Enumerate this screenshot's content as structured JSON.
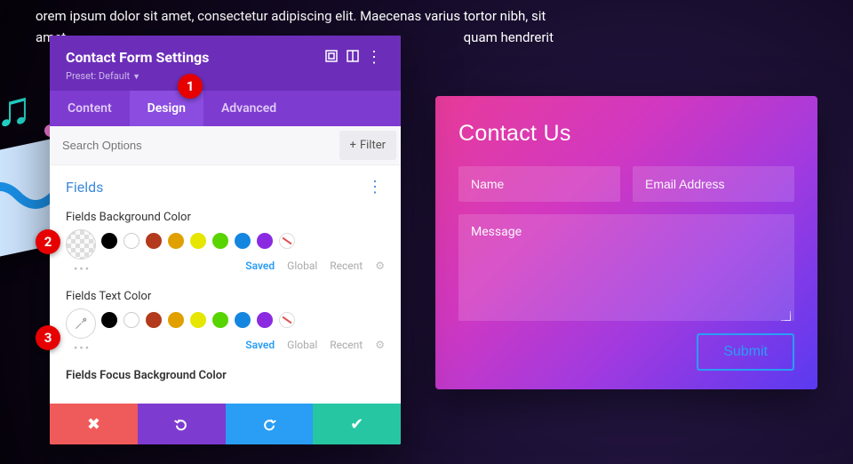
{
  "bg_text": {
    "line1": "orem ipsum dolor sit amet, consectetur adipiscing elit. Maecenas varius tortor nibh, sit",
    "line2_left": "amet",
    "line2_right": "quam hendrerit"
  },
  "callouts": [
    "1",
    "2",
    "3"
  ],
  "panel": {
    "title": "Contact Form Settings",
    "preset": "Preset: Default",
    "tabs": {
      "content": "Content",
      "design": "Design",
      "advanced": "Advanced",
      "active": "design"
    },
    "search_placeholder": "Search Options",
    "filter_label": "Filter",
    "section_title": "Fields",
    "options": {
      "bg": {
        "label": "Fields Background Color",
        "meta": {
          "saved": "Saved",
          "global": "Global",
          "recent": "Recent"
        }
      },
      "text": {
        "label": "Fields Text Color",
        "meta": {
          "saved": "Saved",
          "global": "Global",
          "recent": "Recent"
        }
      },
      "focus_bg": {
        "label": "Fields Focus Background Color"
      }
    },
    "palette": [
      "#000000",
      "#ffffff",
      "#b33a1c",
      "#e0a000",
      "#e6e600",
      "#58d400",
      "#00b36b",
      "#1a8fe6",
      "#8a2be2",
      "none"
    ]
  },
  "preview": {
    "heading": "Contact Us",
    "name_ph": "Name",
    "email_ph": "Email Address",
    "message_ph": "Message",
    "submit": "Submit"
  }
}
